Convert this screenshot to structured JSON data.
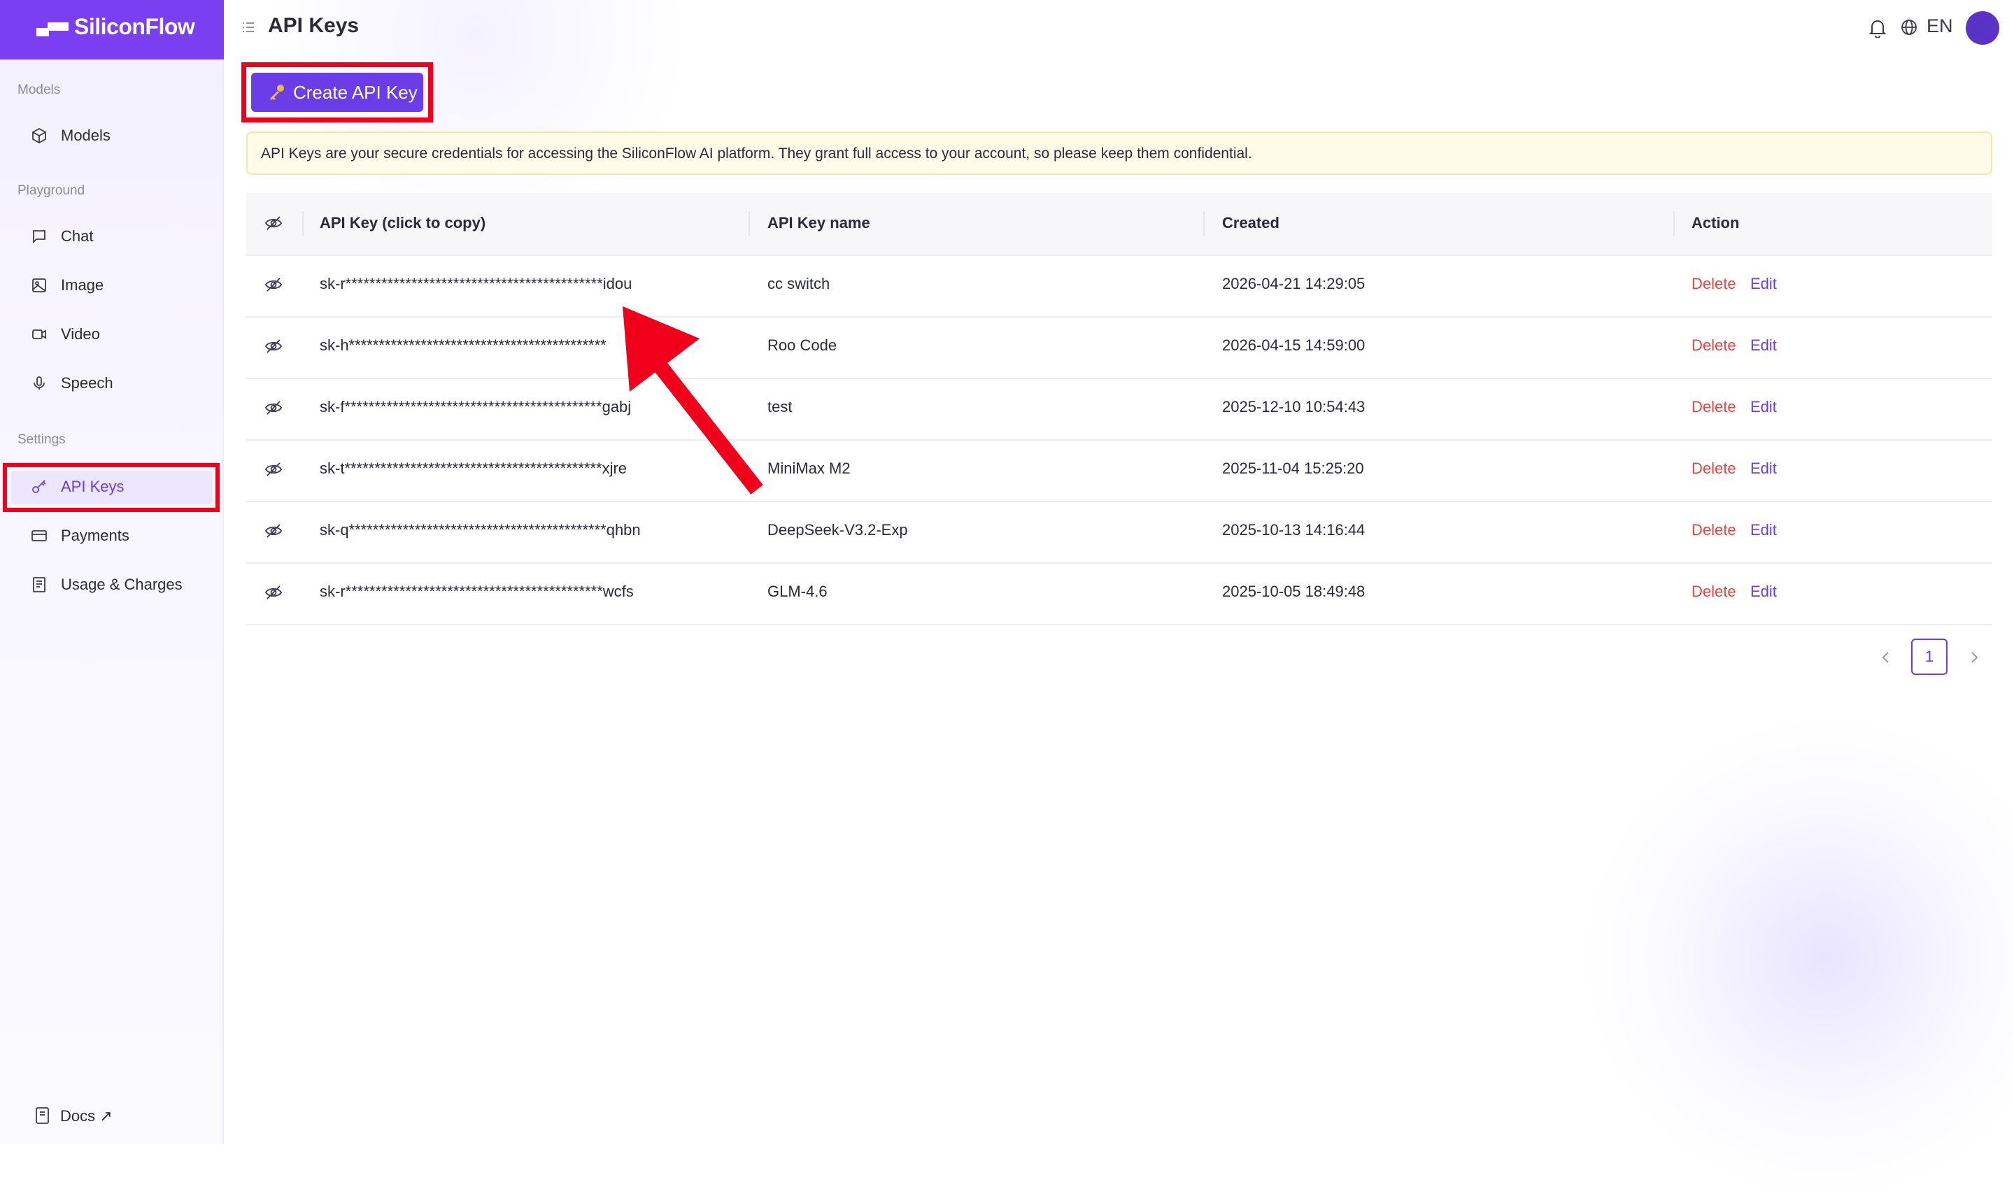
{
  "app": {
    "name": "SiliconFlow"
  },
  "sidebar": {
    "sections": {
      "models": "Models",
      "playground": "Playground",
      "settings": "Settings"
    },
    "items": {
      "models": "Models",
      "chat": "Chat",
      "image": "Image",
      "video": "Video",
      "speech": "Speech",
      "api_keys": "API Keys",
      "payments": "Payments",
      "usage": "Usage & Charges",
      "docs": "Docs ↗"
    },
    "active": "API Keys"
  },
  "header": {
    "title": "API Keys",
    "language": "EN"
  },
  "create_button": {
    "label": "Create API Key"
  },
  "notice": {
    "text": "API Keys are your secure credentials for accessing the SiliconFlow AI platform. They grant full access to your account, so please keep them confidential."
  },
  "table": {
    "columns": {
      "key": "API Key (click to copy)",
      "name": "API Key name",
      "created": "Created",
      "action": "Action"
    },
    "rows": [
      {
        "key": "sk-r*******************************************idou",
        "name": "cc switch",
        "created": "2026-04-21 14:29:05",
        "delete": "Delete",
        "edit": "Edit"
      },
      {
        "key": "sk-h*******************************************",
        "name": "Roo Code",
        "created": "2026-04-15 14:59:00",
        "delete": "Delete",
        "edit": "Edit"
      },
      {
        "key": "sk-f*******************************************gabj",
        "name": "test",
        "created": "2025-12-10 10:54:43",
        "delete": "Delete",
        "edit": "Edit"
      },
      {
        "key": "sk-t*******************************************xjre",
        "name": "MiniMax M2",
        "created": "2025-11-04 15:25:20",
        "delete": "Delete",
        "edit": "Edit"
      },
      {
        "key": "sk-q*******************************************qhbn",
        "name": "DeepSeek-V3.2-Exp",
        "created": "2025-10-13 14:16:44",
        "delete": "Delete",
        "edit": "Edit"
      },
      {
        "key": "sk-r*******************************************wcfs",
        "name": "GLM-4.6",
        "created": "2025-10-05 18:49:48",
        "delete": "Delete",
        "edit": "Edit"
      }
    ]
  },
  "pagination": {
    "current": "1"
  },
  "colors": {
    "brand": "#7b3ff2",
    "primary": "#6a3de8",
    "delete": "#e24848",
    "annotation": "#f0001b",
    "notice_bg": "#fffbe9"
  }
}
